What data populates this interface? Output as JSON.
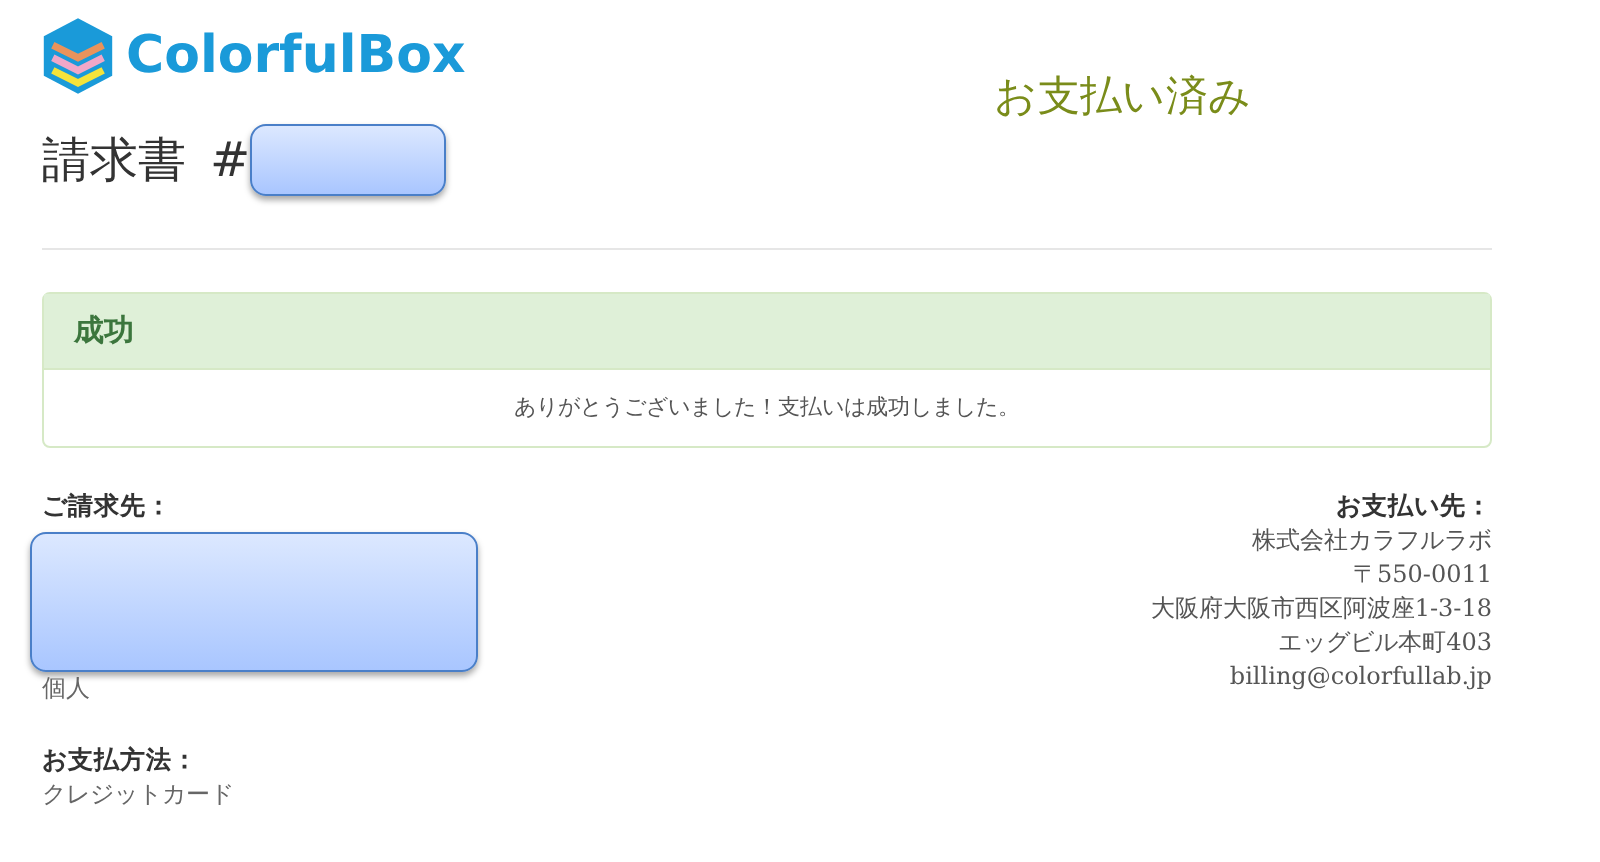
{
  "logo": {
    "text": "ColorfulBox"
  },
  "invoice": {
    "title": "請求書",
    "hash": "#"
  },
  "status": "お支払い済み",
  "alert": {
    "title": "成功",
    "message": "ありがとうございました！支払いは成功しました。"
  },
  "billed_to": {
    "heading": "ご請求先：",
    "lines": [
      "個人"
    ]
  },
  "pay_to": {
    "heading": "お支払い先：",
    "lines": [
      "株式会社カラフルラボ",
      "〒550-0011",
      "大阪府大阪市西区阿波座1-3-18",
      "エッグビル本町403",
      "billing@colorfullab.jp"
    ]
  },
  "payment_method": {
    "heading": "お支払方法：",
    "value": "クレジットカード"
  }
}
